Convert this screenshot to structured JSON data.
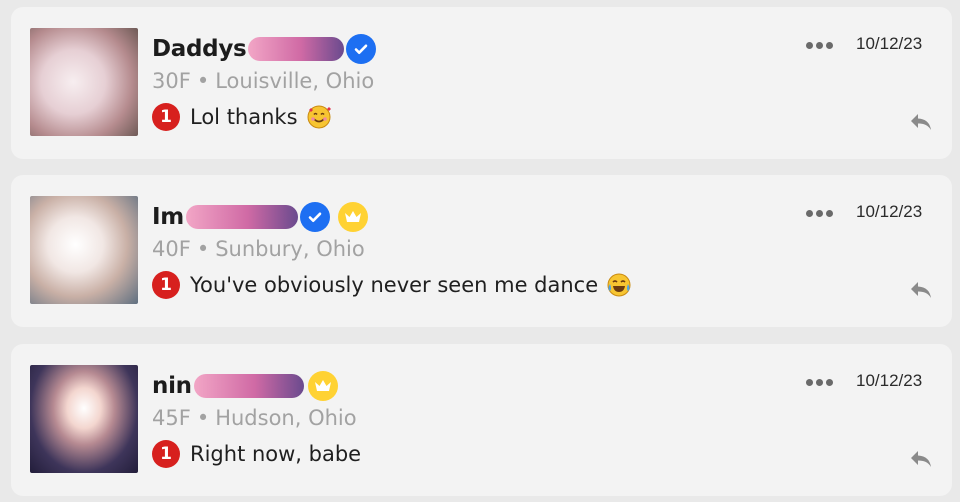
{
  "conversations": [
    {
      "name_visible": "Daddys",
      "verified": true,
      "crown": false,
      "age_gender": "30F",
      "location": "Louisville, Ohio",
      "unread": "1",
      "message": "Lol thanks",
      "emoji": "smiling-face-with-hearts",
      "date": "10/12/23"
    },
    {
      "name_visible": "Im",
      "verified": true,
      "crown": true,
      "age_gender": "40F",
      "location": "Sunbury, Ohio",
      "unread": "1",
      "message": "You've obviously never seen me dance",
      "emoji": "tears-of-joy",
      "date": "10/12/23"
    },
    {
      "name_visible": "nin",
      "verified": false,
      "crown": true,
      "age_gender": "45F",
      "location": "Hudson, Ohio",
      "unread": "1",
      "message": "Right now, babe",
      "emoji": "",
      "date": "10/12/23"
    }
  ],
  "separator": "•",
  "colors": {
    "verified": "#1d6ff2",
    "crown": "#ffd233",
    "unread_badge": "#d7201e",
    "meta_text": "#a2a2a2",
    "redaction": "#d06aa5"
  }
}
